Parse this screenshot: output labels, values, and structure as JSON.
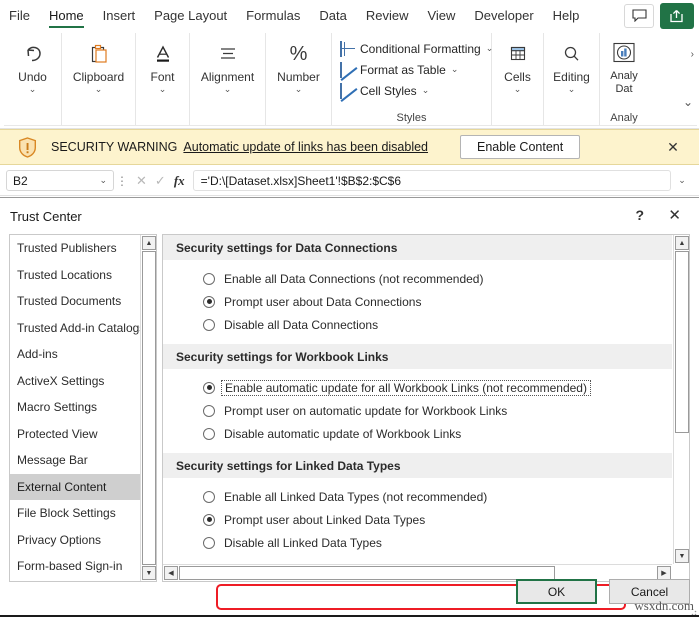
{
  "ribbon": {
    "tabs": [
      {
        "label": "File",
        "active": false
      },
      {
        "label": "Home",
        "active": true
      },
      {
        "label": "Insert",
        "active": false
      },
      {
        "label": "Page Layout",
        "active": false
      },
      {
        "label": "Formulas",
        "active": false
      },
      {
        "label": "Data",
        "active": false
      },
      {
        "label": "Review",
        "active": false
      },
      {
        "label": "View",
        "active": false
      },
      {
        "label": "Developer",
        "active": false
      },
      {
        "label": "Help",
        "active": false
      }
    ],
    "comment_icon": "comment-icon",
    "share_icon": "share-icon",
    "groups": [
      {
        "label": "Undo",
        "icon": "undo-arrow-icon"
      },
      {
        "label": "Clipboard",
        "icon": "clipboard-icon"
      },
      {
        "label": "Font",
        "icon": "font-a-icon"
      },
      {
        "label": "Alignment",
        "icon": "alignment-lines-icon"
      },
      {
        "label": "Number",
        "icon": "percent-icon"
      }
    ],
    "styles": {
      "group_name": "Styles",
      "items": [
        {
          "label": "Conditional Formatting",
          "icon": "conditional-formatting-icon"
        },
        {
          "label": "Format as Table",
          "icon": "format-as-table-icon"
        },
        {
          "label": "Cell Styles",
          "icon": "cell-styles-icon"
        }
      ]
    },
    "cells": {
      "label": "Cells",
      "icon": "cells-table-icon"
    },
    "editing": {
      "label": "Editing",
      "icon": "magnifier-icon"
    },
    "analyze": {
      "label_line1": "Analy",
      "label_line2": "Dat",
      "group_name": "Analy",
      "icon": "analyze-data-icon"
    },
    "accent_green": "#217346"
  },
  "security_bar": {
    "icon": "shield-warning-icon",
    "title": "SECURITY WARNING",
    "message": "Automatic update of links has been disabled",
    "button": "Enable Content",
    "close_icon": "close-icon",
    "background": "#fdf3cd"
  },
  "formula_bar": {
    "name_box_value": "B2",
    "name_box_chevron": "chevron-down-icon",
    "cancel_icon": "cancel-x-icon",
    "confirm_icon": "confirm-check-icon",
    "function_icon": "fx-icon",
    "formula": "='D:\\[Dataset.xlsx]Sheet1'!$B$2:$C$6",
    "expand_icon": "chevron-down-icon"
  },
  "dialog": {
    "title": "Trust Center",
    "help_icon": "help-question-icon",
    "close_icon": "close-icon",
    "sidebar": {
      "items": [
        {
          "label": "Trusted Publishers",
          "selected": false
        },
        {
          "label": "Trusted Locations",
          "selected": false
        },
        {
          "label": "Trusted Documents",
          "selected": false
        },
        {
          "label": "Trusted Add-in Catalogs",
          "selected": false
        },
        {
          "label": "Add-ins",
          "selected": false
        },
        {
          "label": "ActiveX Settings",
          "selected": false
        },
        {
          "label": "Macro Settings",
          "selected": false
        },
        {
          "label": "Protected View",
          "selected": false
        },
        {
          "label": "Message Bar",
          "selected": false
        },
        {
          "label": "External Content",
          "selected": true
        },
        {
          "label": "File Block Settings",
          "selected": false
        },
        {
          "label": "Privacy Options",
          "selected": false
        },
        {
          "label": "Form-based Sign-in",
          "selected": false
        }
      ]
    },
    "sections": [
      {
        "heading": "Security settings for Data Connections",
        "options": [
          {
            "label": "Enable all Data Connections (not recommended)",
            "accel": "E",
            "selected": false
          },
          {
            "label": "Prompt user about Data Connections",
            "accel": "P",
            "selected": true
          },
          {
            "label": "Disable all Data Connections",
            "accel": "D",
            "selected": false
          }
        ]
      },
      {
        "heading": "Security settings for Workbook Links",
        "options": [
          {
            "label": "Enable automatic update for all Workbook Links (not recommended)",
            "accel": "a",
            "selected": true,
            "focused": true
          },
          {
            "label": "Prompt user on automatic update for Workbook Links",
            "accel": "r",
            "selected": false
          },
          {
            "label": "Disable automatic update of Workbook Links",
            "accel": "i",
            "selected": false
          }
        ]
      },
      {
        "heading": "Security settings for Linked Data Types",
        "options": [
          {
            "label": "Enable all Linked Data Types (not recommended)",
            "accel": "n",
            "selected": false
          },
          {
            "label": "Prompt user about Linked Data Types",
            "accel": "o",
            "selected": true
          },
          {
            "label": "Disable all Linked Data Types",
            "accel": "s",
            "selected": false
          }
        ]
      }
    ],
    "highlight_color": "#ee1c25",
    "buttons": {
      "ok": "OK",
      "cancel": "Cancel"
    }
  },
  "watermark": "wsxdn.com"
}
